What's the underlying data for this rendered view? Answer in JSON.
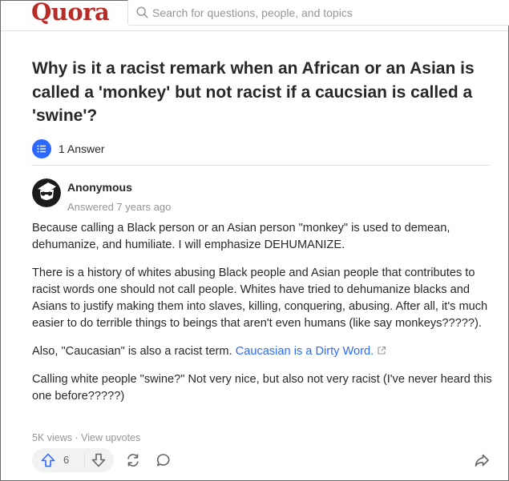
{
  "header": {
    "logo": "Quora",
    "search_placeholder": "Search for questions, people, and topics"
  },
  "question": {
    "title": "Why is it a racist remark when an African or an Asian is called a 'monkey' but not racist if a caucsian is called a 'swine'?",
    "answer_count_label": "1 Answer"
  },
  "answer": {
    "author": "Anonymous",
    "answered": "Answered 7 years ago",
    "paragraphs": [
      "Because calling a Black person or an Asian person \"monkey\" is used to demean, dehumanize, and humiliate. I will emphasize DEHUMANIZE.",
      "There is a history of whites abusing Black people and Asian people that contributes to racist words one should not call people. Whites have tried to dehumanize blacks and Asians to justify making them into slaves, killing, conquering, abusing. After all, it's much easier to do terrible things to beings that aren't even humans (like say monkeys?????).",
      "Calling white people \"swine?\" Not very nice, but also not very racist (I've never heard this one before?????)"
    ],
    "also_text": "Also, \"Caucasian\" is also a racist term. ",
    "link_text": "Caucasian is a Dirty Word.",
    "stats": "5K views · View upvotes",
    "upvote_count": "6"
  },
  "colors": {
    "brand": "#b92b27",
    "accent": "#2e69ff",
    "muted": "#939598"
  },
  "icons": [
    "search-icon",
    "answers-list-icon",
    "external-link-icon",
    "upvote-icon",
    "downvote-icon",
    "reshare-icon",
    "comment-icon",
    "forward-icon"
  ]
}
